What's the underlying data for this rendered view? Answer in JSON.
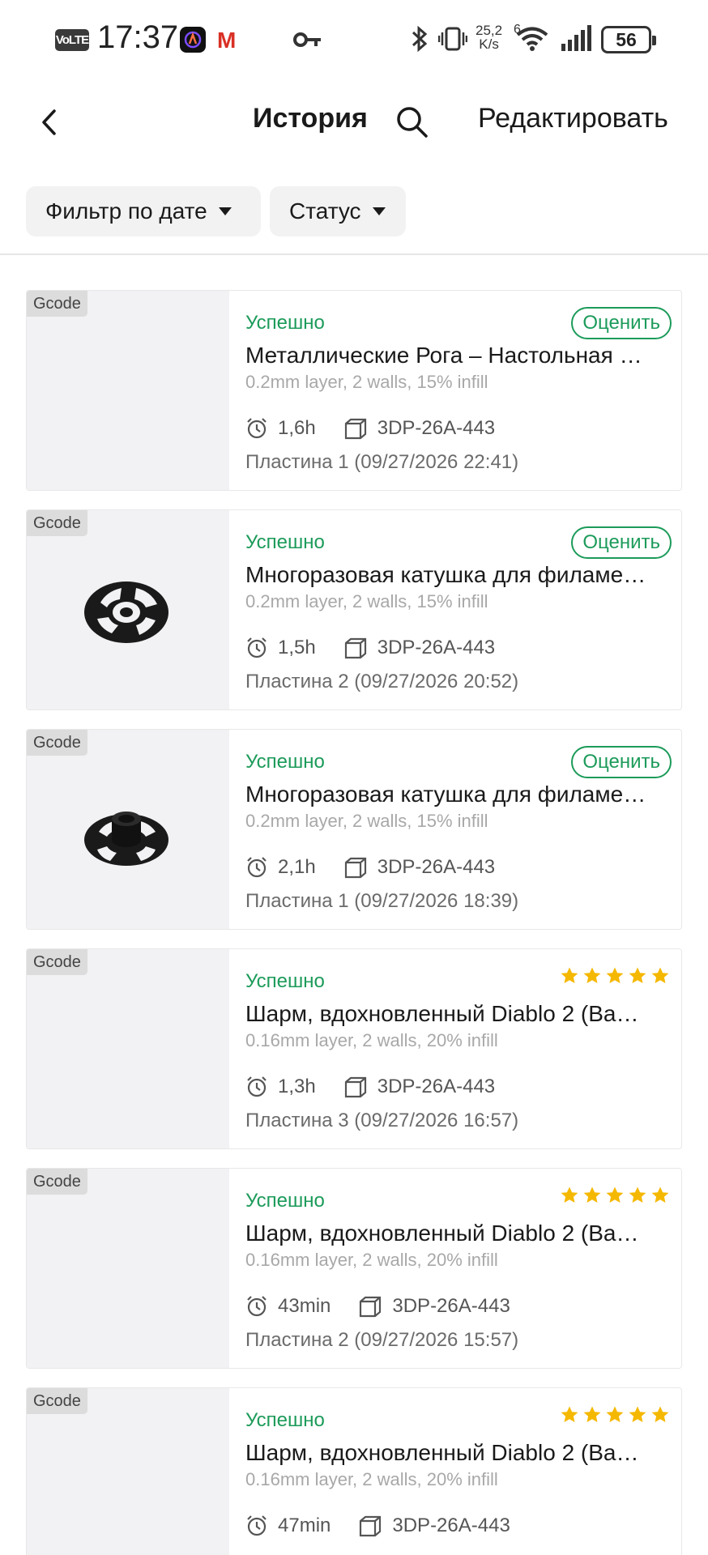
{
  "statusbar": {
    "volte": "VoLTE",
    "time": "17:37",
    "app_gmail": "M",
    "net_speed_value": "25,2",
    "net_speed_unit": "K/s",
    "wifi_badge": "6",
    "battery": "56"
  },
  "header": {
    "title": "История",
    "edit_label": "Редактировать"
  },
  "filters": {
    "date_label": "Фильтр по дате",
    "status_label": "Статус"
  },
  "colors": {
    "success": "#1c9b5a",
    "star": "#f5b800",
    "thumb_bg": "#f2f1f4"
  },
  "jobs": [
    {
      "badge": "Gcode",
      "status": "Успешно",
      "rate_label": "Оценить",
      "rated": false,
      "name": "Металлические Рога – Настольная …",
      "params": "0.2mm layer, 2 walls, 15% infill",
      "duration": "1,6h",
      "printer": "3DP-26A-443",
      "plate": "Пластина 1",
      "datetime": "(09/27/2026 22:41)",
      "thumbnail": "empty"
    },
    {
      "badge": "Gcode",
      "status": "Успешно",
      "rate_label": "Оценить",
      "rated": false,
      "name": "Многоразовая катушка для филаме…",
      "params": "0.2mm layer, 2 walls, 15% infill",
      "duration": "1,5h",
      "printer": "3DP-26A-443",
      "plate": "Пластина 2",
      "datetime": "(09/27/2026 20:52)",
      "thumbnail": "spool-top-icon"
    },
    {
      "badge": "Gcode",
      "status": "Успешно",
      "rate_label": "Оценить",
      "rated": false,
      "name": "Многоразовая катушка для филаме…",
      "params": "0.2mm layer, 2 walls, 15% infill",
      "duration": "2,1h",
      "printer": "3DP-26A-443",
      "plate": "Пластина 1",
      "datetime": "(09/27/2026 18:39)",
      "thumbnail": "spool-hub-icon"
    },
    {
      "badge": "Gcode",
      "status": "Успешно",
      "rating": 5,
      "rated": true,
      "name": "Шарм, вдохновленный Diablo 2 (Ва…",
      "params": "0.16mm layer, 2 walls, 20% infill",
      "duration": "1,3h",
      "printer": "3DP-26A-443",
      "plate": "Пластина 3",
      "datetime": "(09/27/2026 16:57)",
      "thumbnail": "empty"
    },
    {
      "badge": "Gcode",
      "status": "Успешно",
      "rating": 5,
      "rated": true,
      "name": "Шарм, вдохновленный Diablo 2 (Ва…",
      "params": "0.16mm layer, 2 walls, 20% infill",
      "duration": "43min",
      "printer": "3DP-26A-443",
      "plate": "Пластина 2",
      "datetime": "(09/27/2026 15:57)",
      "thumbnail": "empty"
    },
    {
      "badge": "Gcode",
      "status": "Успешно",
      "rating": 5,
      "rated": true,
      "name": "Шарм, вдохновленный Diablo 2 (Ва…",
      "params": "0.16mm layer, 2 walls, 20% infill",
      "duration": "47min",
      "printer": "3DP-26A-443",
      "plate": "",
      "datetime": "",
      "thumbnail": "empty"
    }
  ]
}
